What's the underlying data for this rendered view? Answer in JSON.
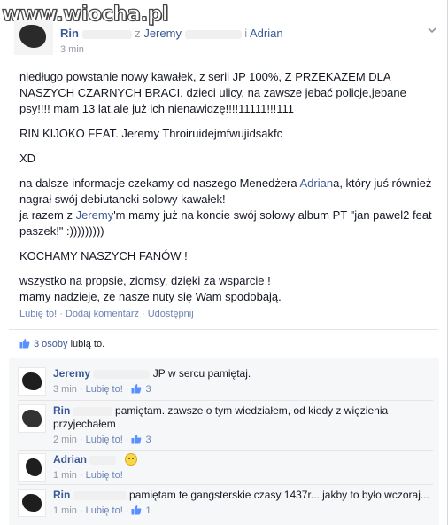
{
  "watermark": "www.wiocha.pl",
  "post": {
    "author": "Rin",
    "with_prefix": "z",
    "tagged_1": "Jeremy",
    "tagged_conj": "i",
    "tagged_2": "Adrian",
    "time": "3 min",
    "paragraphs": {
      "p1": "niedługo powstanie nowy kawałek, z serii JP 100%, Z PRZEKAZEM DLA NASZYCH CZARNYCH BRACI, dzieci ulicy, na zawsze jebać policje,jebane psy!!!! mam 13 lat,ale już ich nienawidzę!!!!11111!!!111",
      "p2": "RIN KIJOKO FEAT. Jeremy Throiruidejmfwujidsakfc",
      "p3": "XD",
      "p4a": "na dalsze informacje czekamy od naszego Menedżera ",
      "p4_mention": "Adrian",
      "p4b": "a, który juś również nagrał swój debiutancki solowy kawałek!",
      "p4c": "ja razem z ",
      "p4_mention2": "Jeremy",
      "p4d": "'m mamy już na koncie swój solowy album PT \"jan pawel2 feat paszek!\" :)))))))))",
      "p5": "KOCHAMY NASZYCH FANÓW !",
      "p6a": "wszystko na propsie, ziomsy, dzięki za wsparcie !",
      "p6b": "mamy nadzieje, ze nasze nuty się Wam spodobają."
    },
    "actions": {
      "like": "Lubię to!",
      "comment": "Dodaj komentarz",
      "share": "Udostępnij"
    },
    "likes": {
      "count_text": "3 osoby",
      "suffix": "lubią to."
    }
  },
  "comments": [
    {
      "name": "Jeremy",
      "text": "JP w sercu pamiętaj.",
      "time": "3 min",
      "like": "Lubię to!",
      "likes": "3"
    },
    {
      "name": "Rin",
      "text": "pamiętam. zawsze o tym wiedziałem, od kiedy z więzienia przyjechałem",
      "time": "2 min",
      "like": "Lubię to!",
      "likes": "3"
    },
    {
      "name": "Adrian",
      "text": "",
      "time": "1 min",
      "like": "Lubię to!",
      "likes": ""
    },
    {
      "name": "Rin",
      "text": "pamiętam te gangsterskie czasy 1437r... jakby to było wczoraj...",
      "time": "1 min",
      "like": "Lubię to!",
      "likes": "1"
    }
  ],
  "colors": {
    "link": "#3b5998",
    "meta": "#9197a3",
    "action": "#6d84b4",
    "comments_bg": "#f6f7f9"
  },
  "icons": {
    "post_menu": "chevron-down-icon",
    "like": "thumbs-up-icon",
    "emoji": "smiley-emoji-icon"
  }
}
